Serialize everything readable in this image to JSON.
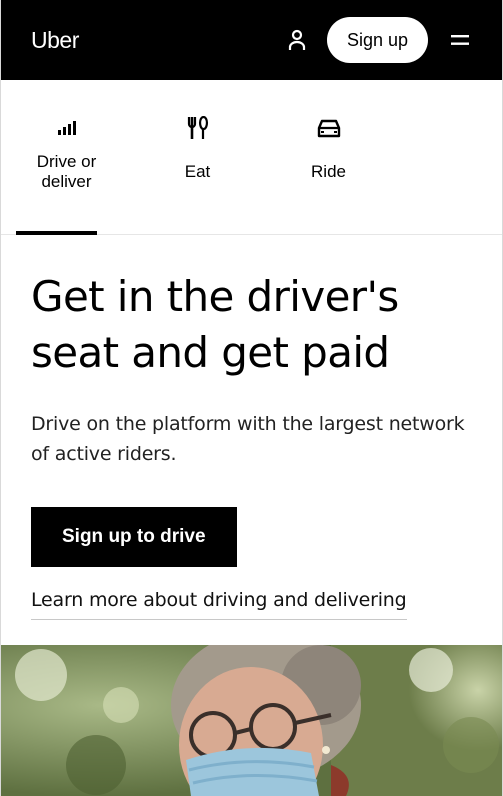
{
  "header": {
    "logo": "Uber",
    "account_icon": "person-icon",
    "signup_label": "Sign up",
    "menu_icon": "hamburger-menu-icon"
  },
  "tabs": [
    {
      "label": "Drive or deliver",
      "icon": "signal-bars-icon",
      "active": true
    },
    {
      "label": "Eat",
      "icon": "fork-knife-icon",
      "active": false
    },
    {
      "label": "Ride",
      "icon": "car-icon",
      "active": false
    }
  ],
  "hero": {
    "headline": "Get in the driver's seat and get paid",
    "subtext": "Drive on the platform with the largest network of active riders.",
    "cta_label": "Sign up to drive",
    "learn_more": "Learn more about driving and delivering"
  },
  "photo": {
    "subject": "woman-with-glasses-and-face-mask"
  },
  "colors": {
    "header_bg": "#000000",
    "cta_bg": "#000000",
    "text": "#000000",
    "background": "#ffffff"
  }
}
